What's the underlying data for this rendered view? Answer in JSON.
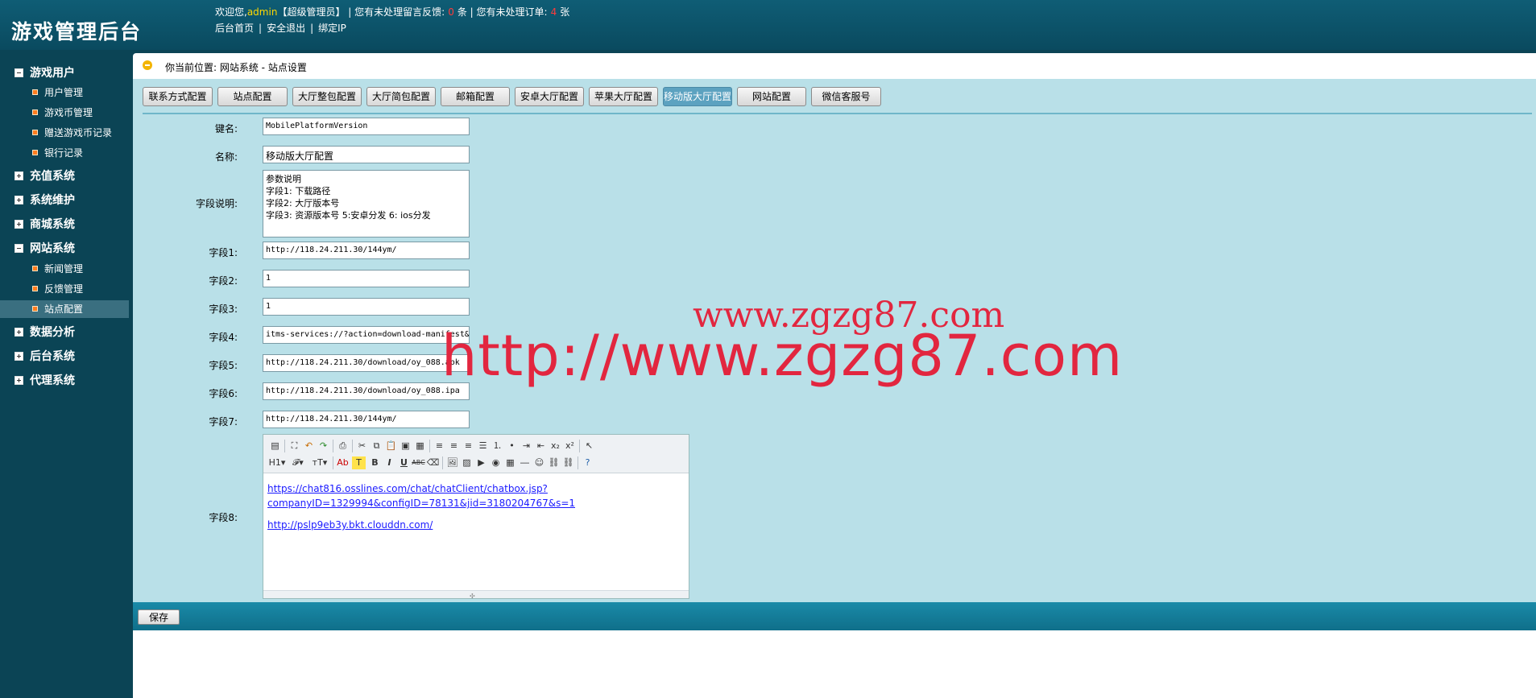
{
  "header": {
    "logo": "游戏管理后台",
    "welcome_prefix": "欢迎您,",
    "admin_name": "admin",
    "admin_role": "【超级管理员】",
    "feedback_prefix": "| 您有未处理留言反馈:",
    "feedback_count": "0",
    "feedback_unit": "条",
    "orders_prefix": "| 您有未处理订单:",
    "orders_count": "4",
    "orders_unit": "张",
    "links": [
      "后台首页",
      "安全退出",
      "绑定IP"
    ]
  },
  "sidebar": {
    "groups": [
      {
        "label": "游戏用户",
        "expanded": true,
        "items": [
          "用户管理",
          "游戏币管理",
          "赠送游戏币记录",
          "银行记录"
        ]
      },
      {
        "label": "充值系统",
        "expanded": false
      },
      {
        "label": "系统维护",
        "expanded": false
      },
      {
        "label": "商城系统",
        "expanded": false
      },
      {
        "label": "网站系统",
        "expanded": true,
        "items": [
          "新闻管理",
          "反馈管理",
          "站点配置"
        ]
      },
      {
        "label": "数据分析",
        "expanded": false
      },
      {
        "label": "后台系统",
        "expanded": false
      },
      {
        "label": "代理系统",
        "expanded": false
      }
    ],
    "active_item": "站点配置"
  },
  "location": "你当前位置: 网站系统 - 站点设置",
  "tabs": [
    "联系方式配置",
    "站点配置",
    "大厅整包配置",
    "大厅简包配置",
    "邮箱配置",
    "安卓大厅配置",
    "苹果大厅配置",
    "移动版大厅配置",
    "网站配置",
    "微信客服号"
  ],
  "active_tab": "移动版大厅配置",
  "form": {
    "key_label": "键名:",
    "key_value": "MobilePlatformVersion",
    "name_label": "名称:",
    "name_value": "移动版大厅配置",
    "desc_label": "字段说明:",
    "desc_lines": [
      "参数说明",
      "字段1: 下载路径",
      "字段2: 大厅版本号",
      "字段3: 资源版本号 5:安卓分发 6: ios分发"
    ],
    "fields": [
      {
        "label": "字段1:",
        "value": "http://118.24.211.30/144ym/"
      },
      {
        "label": "字段2:",
        "value": "1"
      },
      {
        "label": "字段3:",
        "value": "1"
      },
      {
        "label": "字段4:",
        "value": "itms-services://?action=download-manifest&"
      },
      {
        "label": "字段5:",
        "value": "http://118.24.211.30/download/oy_088.apk"
      },
      {
        "label": "字段6:",
        "value": "http://118.24.211.30/download/oy_088.ipa"
      },
      {
        "label": "字段7:",
        "value": "http://118.24.211.30/144ym/"
      }
    ],
    "field8_label": "字段8:",
    "editor_links": [
      "https://chat816.osslines.com/chat/chatClient/chatbox.jsp?",
      "companyID=1329994&configID=78131&jid=3180204767&s=1",
      "http://pslp9eb3y.bkt.clouddn.com/"
    ],
    "save_label": "保存"
  },
  "watermarks": [
    "www.zgzg87.com",
    "http://www.zgzg87.com"
  ],
  "colors": {
    "header": "#0f5d75",
    "sidebar": "#0b4455",
    "panel": "#b9e0e8",
    "active_tab": "#5ca2c0",
    "watermark": "#e2263f",
    "accent_bullet": "#ff7d1e"
  }
}
